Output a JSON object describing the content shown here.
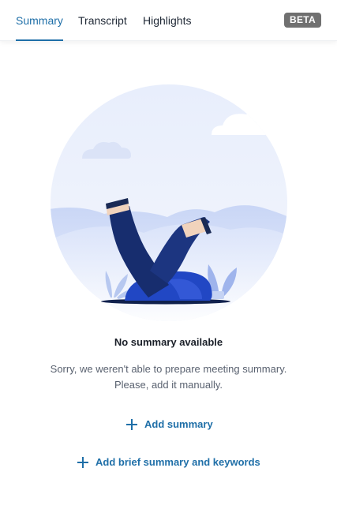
{
  "tabs": [
    {
      "label": "Summary",
      "active": true
    },
    {
      "label": "Transcript",
      "active": false
    },
    {
      "label": "Highlights",
      "active": false
    }
  ],
  "badge": "BETA",
  "illustration": {
    "icon": "person-fallen-in-hole-illustration"
  },
  "empty_state": {
    "title": "No summary available",
    "description": "Sorry, we weren't able to prepare meeting summary. Please, add it manually."
  },
  "actions": {
    "add_summary": "Add summary",
    "add_brief": "Add brief summary and keywords"
  },
  "colors": {
    "accent": "#1f6fa8",
    "badge_bg": "#707070"
  }
}
